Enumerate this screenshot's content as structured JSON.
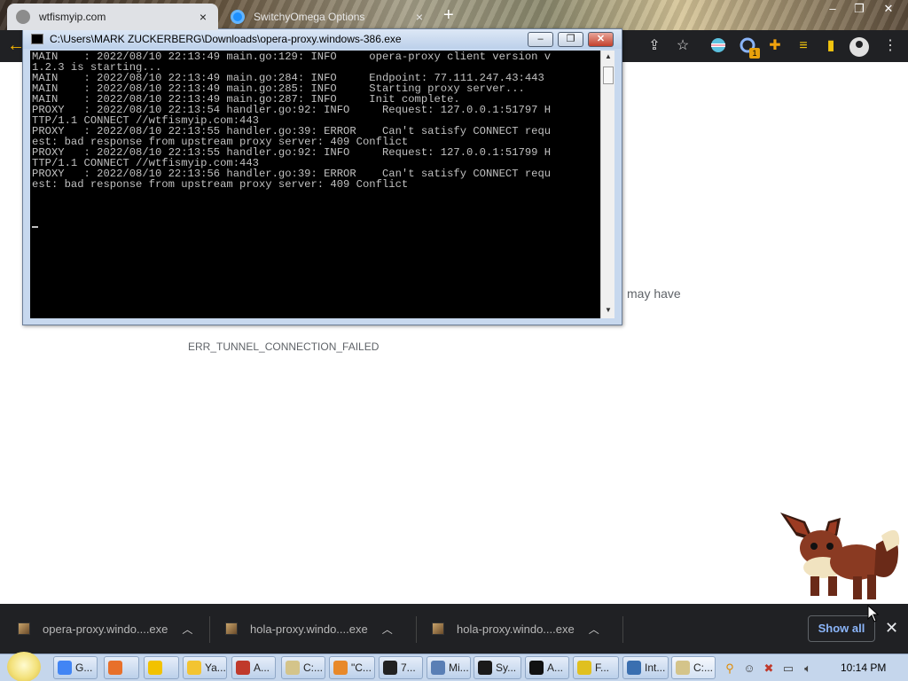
{
  "browser": {
    "tabs": [
      {
        "label": "wtfismyip.com",
        "close": "×"
      },
      {
        "label": "SwitchyOmega Options",
        "close": "×"
      }
    ],
    "new_tab": "+",
    "window_controls": [
      "–",
      "❐",
      "✕"
    ],
    "back": "←",
    "toolbar_icons": [
      "share-icon",
      "star-icon",
      "extension-icon",
      "puzzle-icon",
      "reading-list-icon",
      "side-panel-icon",
      "profile-icon",
      "menu-icon"
    ],
    "extension_badge": "1",
    "accent": "#8ab4f8"
  },
  "page": {
    "partial_text": "may have",
    "error_code": "ERR_TUNNEL_CONNECTION_FAILED"
  },
  "console": {
    "title": "C:\\Users\\MARK ZUCKERBERG\\Downloads\\opera-proxy.windows-386.exe",
    "lines": [
      "MAIN    : 2022/08/10 22:13:49 main.go:129: INFO     opera-proxy client version v",
      "1.2.3 is starting...",
      "MAIN    : 2022/08/10 22:13:49 main.go:284: INFO     Endpoint: 77.111.247.43:443",
      "MAIN    : 2022/08/10 22:13:49 main.go:285: INFO     Starting proxy server...",
      "MAIN    : 2022/08/10 22:13:49 main.go:287: INFO     Init complete.",
      "PROXY   : 2022/08/10 22:13:54 handler.go:92: INFO     Request: 127.0.0.1:51797 H",
      "TTP/1.1 CONNECT //wtfismyip.com:443",
      "PROXY   : 2022/08/10 22:13:55 handler.go:39: ERROR    Can't satisfy CONNECT requ",
      "est: bad response from upstream proxy server: 409 Conflict",
      "PROXY   : 2022/08/10 22:13:55 handler.go:92: INFO     Request: 127.0.0.1:51799 H",
      "TTP/1.1 CONNECT //wtfismyip.com:443",
      "PROXY   : 2022/08/10 22:13:56 handler.go:39: ERROR    Can't satisfy CONNECT requ",
      "est: bad response from upstream proxy server: 409 Conflict"
    ],
    "buttons": {
      "min": "–",
      "max": "❐",
      "close": "✕"
    }
  },
  "downloads": {
    "items": [
      {
        "name": "opera-proxy.windo....exe"
      },
      {
        "name": "hola-proxy.windo....exe"
      },
      {
        "name": "hola-proxy.windo....exe"
      }
    ],
    "show_all": "Show all",
    "close": "✕"
  },
  "taskbar": {
    "buttons": [
      {
        "label": "G...",
        "color": "#4285f4"
      },
      {
        "label": "",
        "color": "#e8702a"
      },
      {
        "label": "",
        "color": "#f2c200"
      },
      {
        "label": "Ya...",
        "color": "#f3c431"
      },
      {
        "label": "A...",
        "color": "#c0392b"
      },
      {
        "label": "C:...",
        "color": "#d4c48a"
      },
      {
        "label": "\"C...",
        "color": "#e8892a"
      },
      {
        "label": "7...",
        "color": "#222222"
      },
      {
        "label": "Mi...",
        "color": "#5a7fb5"
      },
      {
        "label": "Sy...",
        "color": "#1a1a1a"
      },
      {
        "label": "A...",
        "color": "#111111"
      },
      {
        "label": "F...",
        "color": "#e0c020"
      },
      {
        "label": "Int...",
        "color": "#3a6fb0"
      },
      {
        "label": "C:...",
        "color": "#d4c48a"
      }
    ],
    "tray": [
      "search-icon",
      "smiley-icon",
      "network-error-icon",
      "display-icon",
      "volume-icon"
    ],
    "clock": "10:14 PM"
  }
}
